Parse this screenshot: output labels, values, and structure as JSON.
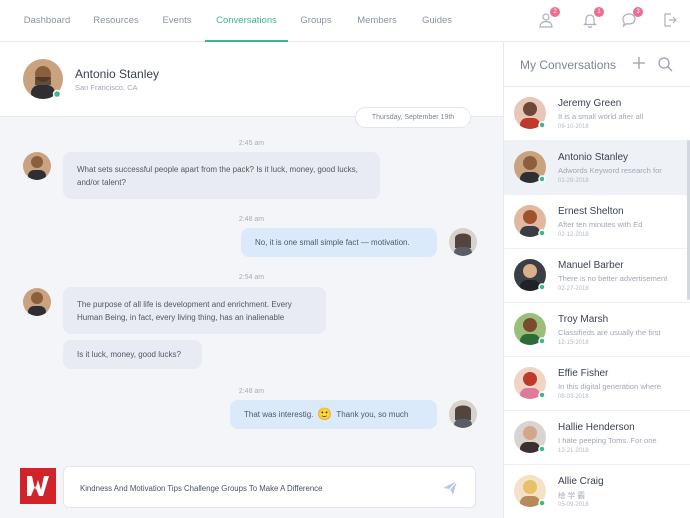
{
  "nav": {
    "items": [
      "Dashboard",
      "Resources",
      "Events",
      "Conversations",
      "Groups",
      "Members",
      "Guides"
    ],
    "active": "Conversations",
    "badges": {
      "users": "2",
      "bell": "1",
      "chat": "3"
    },
    "icons": [
      "users-icon",
      "bell-icon",
      "chat-icon",
      "logout-icon"
    ]
  },
  "chat": {
    "contact_name": "Antonio Stanley",
    "contact_location": "San Francisco, CA",
    "date": "Thursday, September 19th",
    "messages": [
      {
        "time": "2:45 am",
        "from": "them",
        "text": "What sets successful people apart from the pack? Is it luck, money, good lucks, and/or talent?"
      },
      {
        "time": "2:48 am",
        "from": "me",
        "text": "No, it is one small simple fact — motivation."
      },
      {
        "time": "2:54 am",
        "from": "them",
        "text": "The purpose of all life is development and enrichment. Every Human Being, in fact, every living thing, has an inalienable"
      },
      {
        "time": "",
        "from": "them",
        "text": "Is it luck, money, good lucks?"
      },
      {
        "time": "2:48 am",
        "from": "me",
        "text_before": "That was interestig.",
        "emoji": "🙂",
        "text_after": "Thank you, so much"
      }
    ],
    "composer_value": "Kindness And Motivation Tips Challenge Groups To Make A Difference"
  },
  "sidebar": {
    "title": "My Conversations",
    "conversations": [
      {
        "name": "Jeremy Green",
        "preview": "It is a small world after all",
        "date": "09-10-2018"
      },
      {
        "name": "Antonio Stanley",
        "preview": "Adwords Keyword research for",
        "date": "01-29-2018",
        "active": true
      },
      {
        "name": "Ernest Shelton",
        "preview": "After ten minutes with Ed",
        "date": "02-12-2018"
      },
      {
        "name": "Manuel Barber",
        "preview": "There is no better advertisement",
        "date": "02-27-2018"
      },
      {
        "name": "Troy Marsh",
        "preview": "Classifieds are usually the first",
        "date": "12-15-2018"
      },
      {
        "name": "Effie Fisher",
        "preview": "In this digital generation where",
        "date": "08-03-2018"
      },
      {
        "name": "Hallie Henderson",
        "preview": "I hate peeping Toms. For one",
        "date": "12-21-2018"
      },
      {
        "name": "Allie Craig",
        "preview": "绘 学 霸",
        "date": "05-09-2018"
      }
    ]
  },
  "colors": {
    "accent": "#3bb98d",
    "badge": "#ef6c93",
    "bubble_in": "#e8ebf1",
    "bubble_out": "#dbeafb",
    "logo": "#d1232a"
  }
}
